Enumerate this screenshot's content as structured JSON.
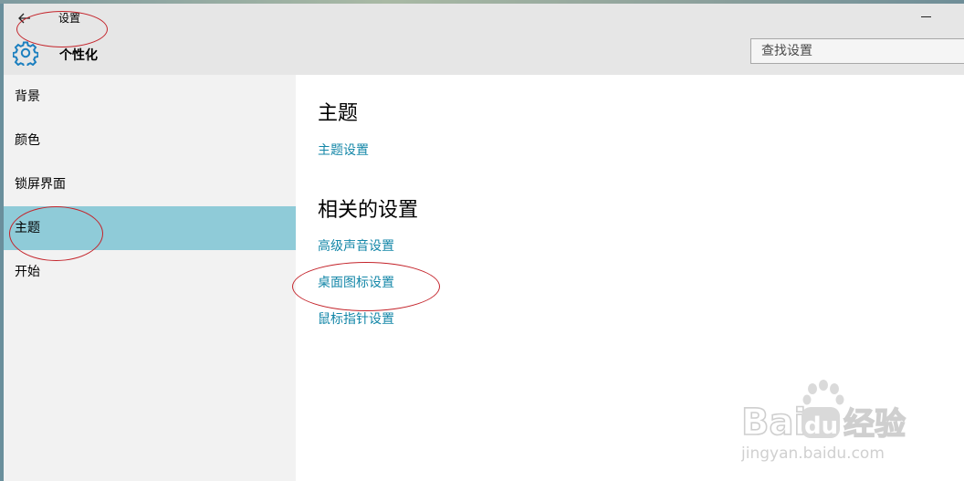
{
  "window": {
    "title": "设置"
  },
  "header": {
    "heading": "个性化"
  },
  "search": {
    "placeholder": "查找设置"
  },
  "sidebar": {
    "items": [
      {
        "label": "背景"
      },
      {
        "label": "颜色"
      },
      {
        "label": "锁屏界面"
      },
      {
        "label": "主题",
        "selected": true
      },
      {
        "label": "开始"
      }
    ]
  },
  "main": {
    "theme_title": "主题",
    "theme_link": "主题设置",
    "related_title": "相关的设置",
    "related_links": [
      "高级声音设置",
      "桌面图标设置",
      "鼠标指针设置"
    ]
  },
  "watermark": {
    "line1": "Bai",
    "line1b": "du",
    "line1c": "经验",
    "line2": "jingyan.baidu.com"
  },
  "colors": {
    "accent": "#1487a8",
    "selected_bg": "#8fcbd8",
    "annotation": "#c4242b",
    "gear": "#1b7fbf"
  },
  "icons": {
    "back": "back-arrow-icon",
    "settings": "gear-icon",
    "minimize": "minimize-icon"
  }
}
